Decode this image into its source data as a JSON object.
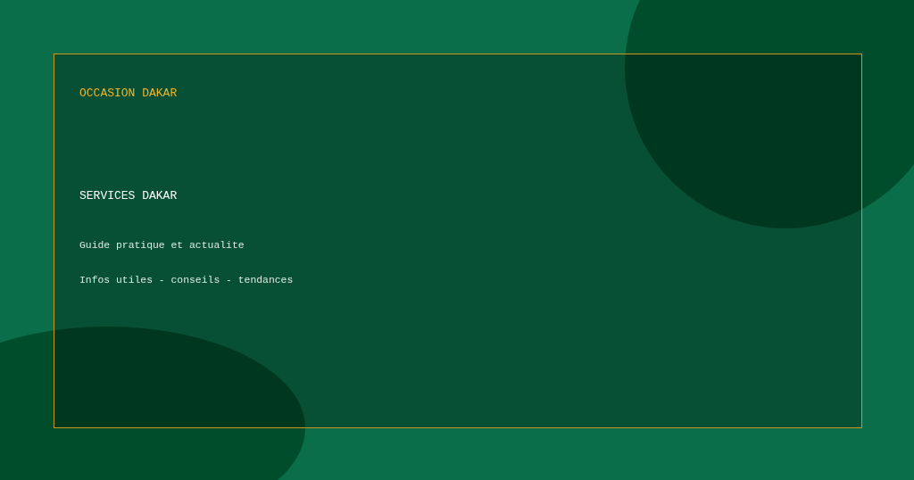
{
  "brand": "OCCASION DAKAR",
  "title": "SERVICES DAKAR",
  "lines": [
    "Guide pratique et actualite",
    "Infos utiles - conseils - tendances"
  ]
}
